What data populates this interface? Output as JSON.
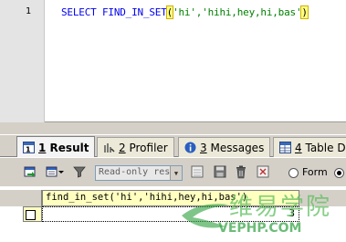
{
  "editor": {
    "line_number": "1",
    "tokens": {
      "kw1": "SELECT",
      "kw2": "FIND_IN_SET",
      "open": "(",
      "args": "'hi','hihi,hey,hi,bas'",
      "close": ")"
    }
  },
  "tabs": [
    {
      "num": "1",
      "label": "Result"
    },
    {
      "num": "2",
      "label": "Profiler"
    },
    {
      "num": "3",
      "label": "Messages"
    },
    {
      "num": "4",
      "label": "Table D"
    }
  ],
  "toolbar": {
    "mode_select": "Read-only res",
    "form_label": "Form"
  },
  "grid": {
    "column_header": "find_in_set('hi','hihi,hey,hi,bas')",
    "rows": [
      {
        "value": "3"
      }
    ]
  },
  "watermark": {
    "cn": "维易学院",
    "url": "VEPHP.COM"
  },
  "colors": {
    "keyword": "#0000ee",
    "string": "#008000",
    "header_bg": "#ffffc0"
  }
}
